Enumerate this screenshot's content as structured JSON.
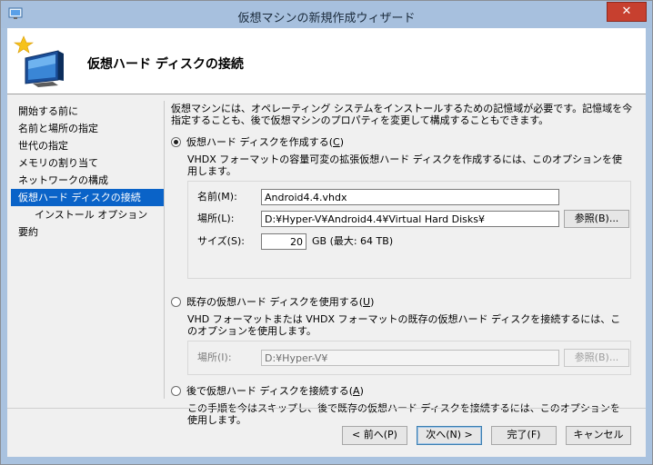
{
  "window": {
    "title": "仮想マシンの新規作成ウィザード",
    "close_label": "✕"
  },
  "header": {
    "title": "仮想ハード ディスクの接続",
    "icon": "virtual-machine-wizard-icon"
  },
  "nav": {
    "items": [
      {
        "label": "開始する前に",
        "selected": false,
        "sub": false
      },
      {
        "label": "名前と場所の指定",
        "selected": false,
        "sub": false
      },
      {
        "label": "世代の指定",
        "selected": false,
        "sub": false
      },
      {
        "label": "メモリの割り当て",
        "selected": false,
        "sub": false
      },
      {
        "label": "ネットワークの構成",
        "selected": false,
        "sub": false
      },
      {
        "label": "仮想ハード ディスクの接続",
        "selected": true,
        "sub": false
      },
      {
        "label": "インストール オプション",
        "selected": false,
        "sub": true
      },
      {
        "label": "要約",
        "selected": false,
        "sub": false
      }
    ]
  },
  "content": {
    "intro": "仮想マシンには、オペレーティング システムをインストールするための記憶域が必要です。記憶域を今指定することも、後で仮想マシンのプロパティを変更して構成することもできます。",
    "option_create": {
      "label_main": "仮想ハード ディスクを作成する(",
      "label_key": "C",
      "label_end": ")",
      "description": "VHDX フォーマットの容量可変の拡張仮想ハード ディスクを作成するには、このオプションを使用します。",
      "name_label": "名前(M):",
      "name_value": "Android4.4.vhdx",
      "location_label": "場所(L):",
      "location_value": "D:¥Hyper-V¥Android4.4¥Virtual Hard Disks¥",
      "browse_label": "参照(B)...",
      "size_label": "サイズ(S):",
      "size_value": "20",
      "size_unit": "GB (最大: 64 TB)"
    },
    "option_existing": {
      "label_main": "既存の仮想ハード ディスクを使用する(",
      "label_key": "U",
      "label_end": ")",
      "description": "VHD フォーマットまたは VHDX フォーマットの既存の仮想ハード ディスクを接続するには、このオプションを使用します。",
      "location_label": "場所(I):",
      "location_value": "D:¥Hyper-V¥",
      "browse_label": "参照(B)..."
    },
    "option_later": {
      "label_main": "後で仮想ハード ディスクを接続する(",
      "label_key": "A",
      "label_end": ")",
      "description": "この手順を今はスキップし、後で既存の仮想ハード ディスクを接続するには、このオプションを使用します。"
    }
  },
  "footer": {
    "back_label": "< 前へ(P)",
    "next_label": "次へ(N) >",
    "finish_label": "完了(F)",
    "cancel_label": "キャンセル"
  },
  "colors": {
    "titlebar": "#a7c0de",
    "selection": "#0a63c8",
    "close": "#c7402f"
  }
}
